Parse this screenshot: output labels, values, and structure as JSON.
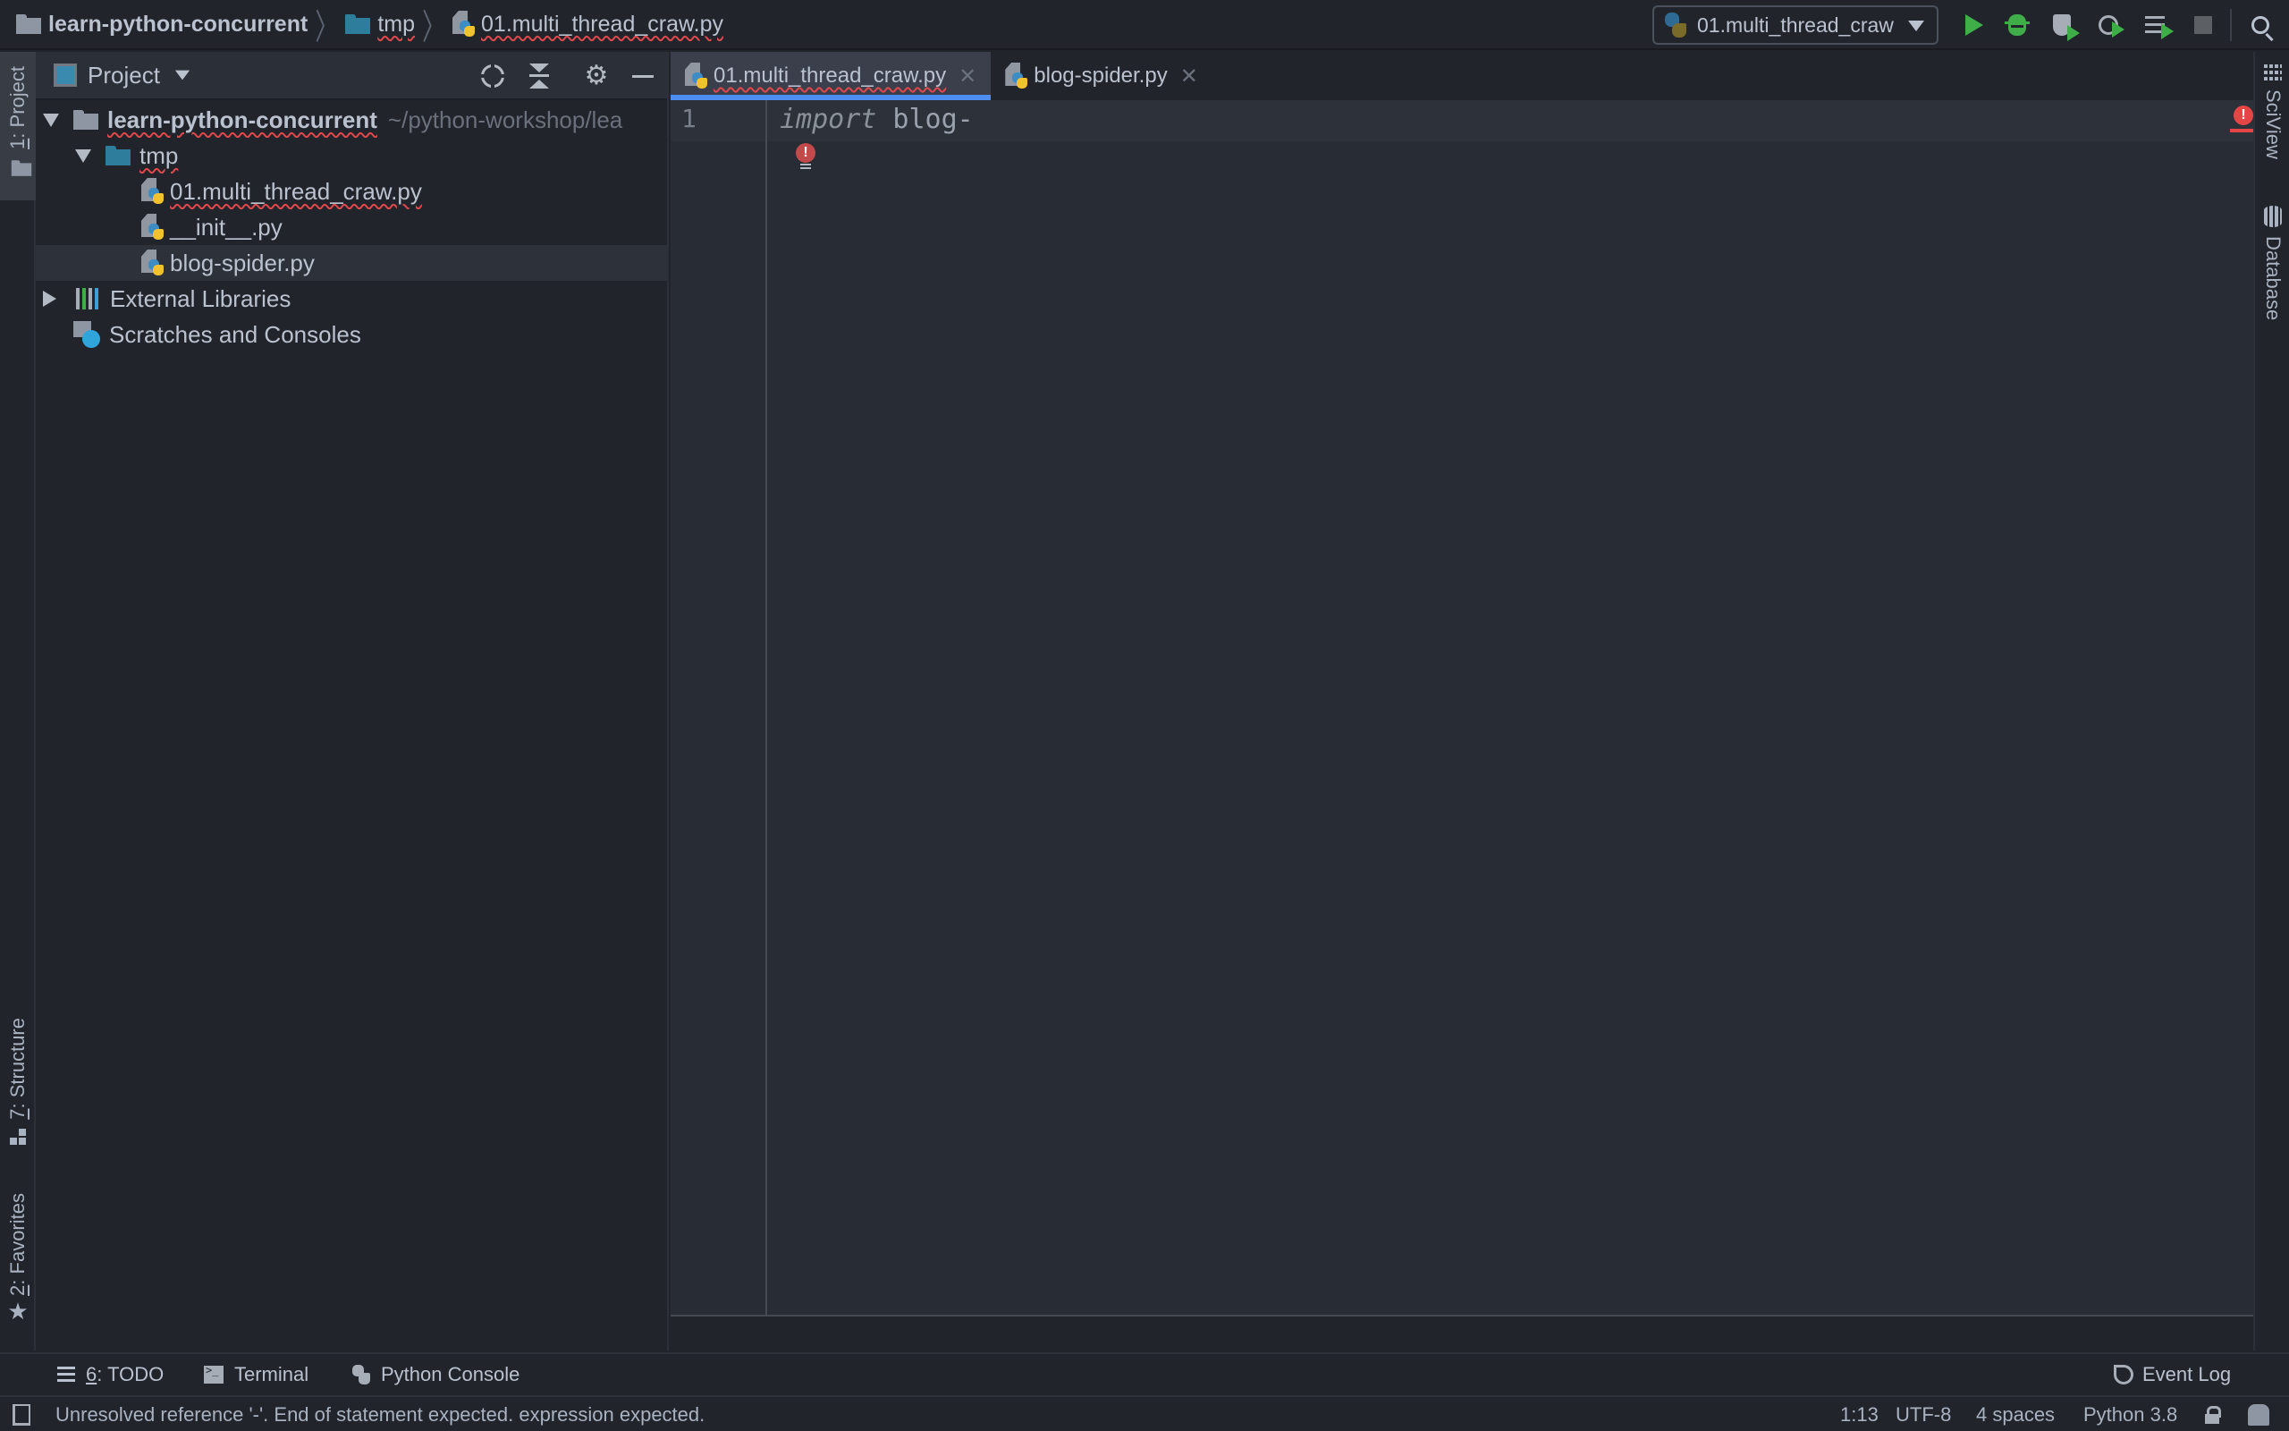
{
  "navbar": {
    "breadcrumbs": [
      {
        "label": "learn-python-concurrent",
        "icon": "folder-icon"
      },
      {
        "label": "tmp",
        "icon": "folder-icon"
      },
      {
        "label": "01.multi_thread_craw.py",
        "icon": "python-file-icon"
      }
    ],
    "run_config": {
      "label": "01.multi_thread_craw",
      "icon": "python-icon"
    },
    "actions": [
      "run",
      "debug",
      "run-with-coverage",
      "profile",
      "concurrency-diagram",
      "stop",
      "search"
    ]
  },
  "left_strip": {
    "project": {
      "num": "1",
      "label": ": Project"
    },
    "structure": {
      "num": "7",
      "label": ": Structure"
    },
    "favorites": {
      "num": "2",
      "label": ": Favorites"
    }
  },
  "project_panel": {
    "title": "Project",
    "tree": [
      {
        "label": "learn-python-concurrent",
        "path": "~/python-workshop/lea",
        "level": 0,
        "type": "folder",
        "expanded": true
      },
      {
        "label": "tmp",
        "level": 1,
        "type": "folder",
        "expanded": true
      },
      {
        "label": "01.multi_thread_craw.py",
        "level": 2,
        "type": "python-file"
      },
      {
        "label": "__init__.py",
        "level": 2,
        "type": "python-file"
      },
      {
        "label": "blog-spider.py",
        "level": 2,
        "type": "python-file",
        "selected": true
      },
      {
        "label": "External Libraries",
        "level": 0,
        "type": "libraries",
        "expanded": false
      },
      {
        "label": "Scratches and Consoles",
        "level": 0,
        "type": "scratches"
      }
    ]
  },
  "editor": {
    "tabs": [
      {
        "label": "01.multi_thread_craw.py",
        "active": true
      },
      {
        "label": "blog-spider.py",
        "active": false
      }
    ],
    "lines": [
      {
        "number": "1",
        "keyword": "import",
        "rest": " blog-"
      }
    ],
    "error_mark": "!"
  },
  "right_strip": {
    "sciview": "SciView",
    "database": "Database"
  },
  "tool_windows": {
    "todo": {
      "num": "6",
      "label": ": TODO"
    },
    "terminal": "Terminal",
    "python_console": "Python Console",
    "event_log": "Event Log"
  },
  "status_bar": {
    "message": "Unresolved reference '-'. End of statement expected. expression expected.",
    "position": "1:13",
    "encoding": "UTF-8",
    "indent": "4 spaces",
    "interpreter": "Python 3.8"
  },
  "colors": {
    "accent": "#4d8ef0",
    "error": "#e54545",
    "run_green": "#3fae49",
    "background": "#21242b",
    "editor_bg": "#282c34"
  }
}
